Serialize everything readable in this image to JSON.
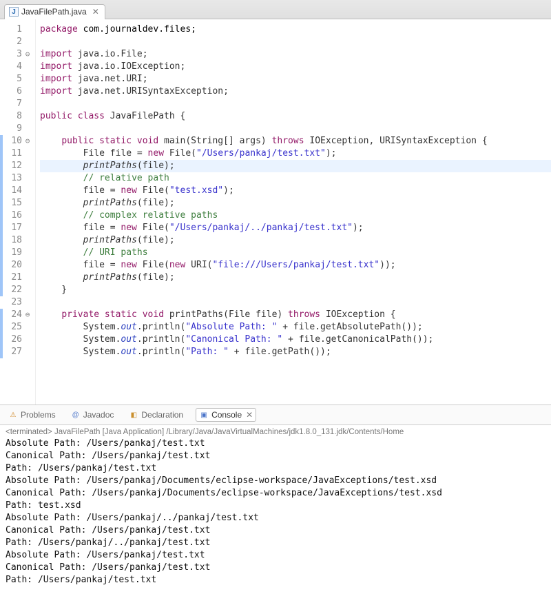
{
  "tab": {
    "label": "JavaFilePath.java"
  },
  "code": {
    "lines": [
      {
        "n": "1",
        "mod": false,
        "fold": "",
        "tokens": [
          [
            "kw",
            "package"
          ],
          [
            "",
            ""
          ],
          [
            "type",
            " com.journaldev.files;"
          ]
        ]
      },
      {
        "n": "2",
        "mod": false,
        "fold": "",
        "tokens": [
          [
            "",
            ""
          ]
        ]
      },
      {
        "n": "3",
        "mod": false,
        "fold": "⊖",
        "tokens": [
          [
            "kw",
            "import"
          ],
          [
            "",
            " java.io.File;"
          ]
        ]
      },
      {
        "n": "4",
        "mod": false,
        "fold": "",
        "tokens": [
          [
            "kw",
            "import"
          ],
          [
            "",
            " java.io.IOException;"
          ]
        ]
      },
      {
        "n": "5",
        "mod": false,
        "fold": "",
        "tokens": [
          [
            "kw",
            "import"
          ],
          [
            "",
            " java.net.URI;"
          ]
        ]
      },
      {
        "n": "6",
        "mod": false,
        "fold": "",
        "tokens": [
          [
            "kw",
            "import"
          ],
          [
            "",
            " java.net.URISyntaxException;"
          ]
        ]
      },
      {
        "n": "7",
        "mod": false,
        "fold": "",
        "tokens": [
          [
            "",
            ""
          ]
        ]
      },
      {
        "n": "8",
        "mod": false,
        "fold": "",
        "tokens": [
          [
            "kw",
            "public class"
          ],
          [
            "",
            " JavaFilePath {"
          ]
        ]
      },
      {
        "n": "9",
        "mod": false,
        "fold": "",
        "tokens": [
          [
            "",
            ""
          ]
        ]
      },
      {
        "n": "10",
        "mod": true,
        "fold": "⊖",
        "tokens": [
          [
            "",
            "    "
          ],
          [
            "kw",
            "public static void"
          ],
          [
            "",
            " main(String[] args) "
          ],
          [
            "kw",
            "throws"
          ],
          [
            "",
            " IOException, URISyntaxException {"
          ]
        ]
      },
      {
        "n": "11",
        "mod": true,
        "fold": "",
        "tokens": [
          [
            "",
            "        File file = "
          ],
          [
            "kw",
            "new"
          ],
          [
            "",
            " File("
          ],
          [
            "str",
            "\"/Users/pankaj/test.txt\""
          ],
          [
            "",
            ");"
          ]
        ]
      },
      {
        "n": "12",
        "mod": true,
        "fold": "",
        "hl": true,
        "tokens": [
          [
            "",
            "        "
          ],
          [
            "method-ital",
            "printPaths"
          ],
          [
            "",
            "(file);"
          ]
        ]
      },
      {
        "n": "13",
        "mod": true,
        "fold": "",
        "tokens": [
          [
            "",
            "        "
          ],
          [
            "cmt",
            "// relative path"
          ]
        ]
      },
      {
        "n": "14",
        "mod": true,
        "fold": "",
        "tokens": [
          [
            "",
            "        file = "
          ],
          [
            "kw",
            "new"
          ],
          [
            "",
            " File("
          ],
          [
            "str",
            "\"test.xsd\""
          ],
          [
            "",
            ");"
          ]
        ]
      },
      {
        "n": "15",
        "mod": true,
        "fold": "",
        "tokens": [
          [
            "",
            "        "
          ],
          [
            "method-ital",
            "printPaths"
          ],
          [
            "",
            "(file);"
          ]
        ]
      },
      {
        "n": "16",
        "mod": true,
        "fold": "",
        "tokens": [
          [
            "",
            "        "
          ],
          [
            "cmt",
            "// complex relative paths"
          ]
        ]
      },
      {
        "n": "17",
        "mod": true,
        "fold": "",
        "tokens": [
          [
            "",
            "        file = "
          ],
          [
            "kw",
            "new"
          ],
          [
            "",
            " File("
          ],
          [
            "str",
            "\"/Users/pankaj/../pankaj/test.txt\""
          ],
          [
            "",
            ");"
          ]
        ]
      },
      {
        "n": "18",
        "mod": true,
        "fold": "",
        "tokens": [
          [
            "",
            "        "
          ],
          [
            "method-ital",
            "printPaths"
          ],
          [
            "",
            "(file);"
          ]
        ]
      },
      {
        "n": "19",
        "mod": true,
        "fold": "",
        "tokens": [
          [
            "",
            "        "
          ],
          [
            "cmt",
            "// URI paths"
          ]
        ]
      },
      {
        "n": "20",
        "mod": true,
        "fold": "",
        "tokens": [
          [
            "",
            "        file = "
          ],
          [
            "kw",
            "new"
          ],
          [
            "",
            " File("
          ],
          [
            "kw",
            "new"
          ],
          [
            "",
            " URI("
          ],
          [
            "str",
            "\"file:///Users/pankaj/test.txt\""
          ],
          [
            "",
            "));"
          ]
        ]
      },
      {
        "n": "21",
        "mod": true,
        "fold": "",
        "tokens": [
          [
            "",
            "        "
          ],
          [
            "method-ital",
            "printPaths"
          ],
          [
            "",
            "(file);"
          ]
        ]
      },
      {
        "n": "22",
        "mod": true,
        "fold": "",
        "tokens": [
          [
            "",
            "    }"
          ]
        ]
      },
      {
        "n": "23",
        "mod": false,
        "fold": "",
        "tokens": [
          [
            "",
            ""
          ]
        ]
      },
      {
        "n": "24",
        "mod": true,
        "fold": "⊖",
        "tokens": [
          [
            "",
            "    "
          ],
          [
            "kw",
            "private static void"
          ],
          [
            "",
            " printPaths(File file) "
          ],
          [
            "kw",
            "throws"
          ],
          [
            "",
            " IOException {"
          ]
        ]
      },
      {
        "n": "25",
        "mod": true,
        "fold": "",
        "tokens": [
          [
            "",
            "        System."
          ],
          [
            "field",
            "out"
          ],
          [
            "",
            ".println("
          ],
          [
            "str",
            "\"Absolute Path: \""
          ],
          [
            "",
            " + file.getAbsolutePath());"
          ]
        ]
      },
      {
        "n": "26",
        "mod": true,
        "fold": "",
        "tokens": [
          [
            "",
            "        System."
          ],
          [
            "field",
            "out"
          ],
          [
            "",
            ".println("
          ],
          [
            "str",
            "\"Canonical Path: \""
          ],
          [
            "",
            " + file.getCanonicalPath());"
          ]
        ]
      },
      {
        "n": "27",
        "mod": true,
        "fold": "",
        "tokens": [
          [
            "",
            "        System."
          ],
          [
            "field",
            "out"
          ],
          [
            "",
            ".println("
          ],
          [
            "str",
            "\"Path: \""
          ],
          [
            "",
            " + file.getPath());"
          ]
        ]
      }
    ]
  },
  "views": {
    "problems": "Problems",
    "javadoc": "Javadoc",
    "declaration": "Declaration",
    "console": "Console"
  },
  "terminated": "<terminated> JavaFilePath [Java Application] /Library/Java/JavaVirtualMachines/jdk1.8.0_131.jdk/Contents/Home",
  "console_output": [
    "Absolute Path: /Users/pankaj/test.txt",
    "Canonical Path: /Users/pankaj/test.txt",
    "Path: /Users/pankaj/test.txt",
    "Absolute Path: /Users/pankaj/Documents/eclipse-workspace/JavaExceptions/test.xsd",
    "Canonical Path: /Users/pankaj/Documents/eclipse-workspace/JavaExceptions/test.xsd",
    "Path: test.xsd",
    "Absolute Path: /Users/pankaj/../pankaj/test.txt",
    "Canonical Path: /Users/pankaj/test.txt",
    "Path: /Users/pankaj/../pankaj/test.txt",
    "Absolute Path: /Users/pankaj/test.txt",
    "Canonical Path: /Users/pankaj/test.txt",
    "Path: /Users/pankaj/test.txt"
  ]
}
